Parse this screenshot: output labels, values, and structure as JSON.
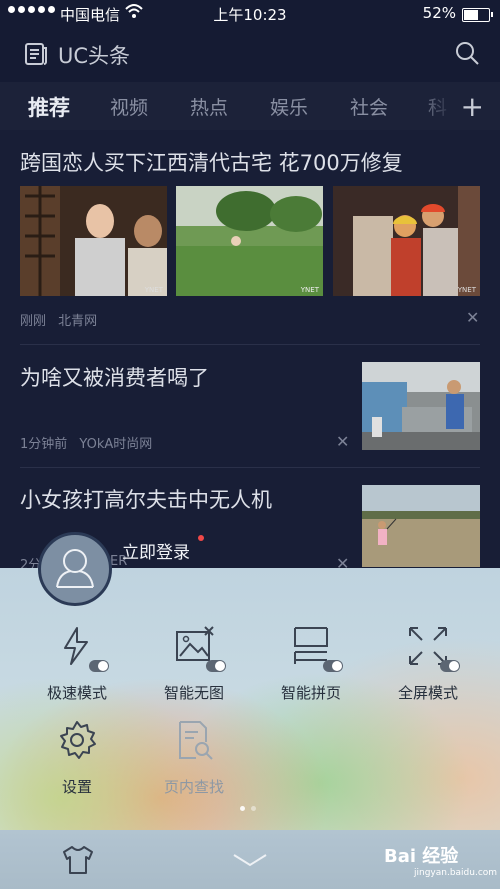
{
  "status_bar": {
    "carrier": "中国电信",
    "time": "上午10:23",
    "battery": "52%"
  },
  "header": {
    "title": "UC头条"
  },
  "tabs": [
    {
      "label": "推荐",
      "active": true
    },
    {
      "label": "视频"
    },
    {
      "label": "热点"
    },
    {
      "label": "娱乐"
    },
    {
      "label": "社会"
    },
    {
      "label": "科"
    }
  ],
  "articles": [
    {
      "title": "跨国恋人买下江西清代古宅 花700万修复",
      "time": "刚刚",
      "source": "北青网",
      "image_labels": [
        "YNET",
        "YNET",
        "YNET"
      ]
    },
    {
      "title": "为啥又被消费者喝了",
      "time": "1分钟前",
      "source": "YOkA时尚网"
    },
    {
      "title": "小女孩打高尔夫击中无人机",
      "meta_partial": "2分",
      "meta_partial2": "ER"
    }
  ],
  "menu": {
    "login": "立即登录",
    "features": [
      {
        "label": "极速模式",
        "icon": "lightning-icon"
      },
      {
        "label": "智能无图",
        "icon": "no-image-icon"
      },
      {
        "label": "智能拼页",
        "icon": "page-merge-icon"
      },
      {
        "label": "全屏模式",
        "icon": "fullscreen-icon"
      },
      {
        "label": "设置",
        "icon": "gear-icon"
      },
      {
        "label": "页内查找",
        "icon": "find-in-page-icon",
        "disabled": true
      }
    ]
  },
  "watermark": {
    "text": "Bai 经验",
    "sub": "jingyan.baidu.com"
  },
  "colors": {
    "background": "#151b33",
    "menu_bg": "#c7d9e2",
    "notification_dot": "#f04848"
  }
}
